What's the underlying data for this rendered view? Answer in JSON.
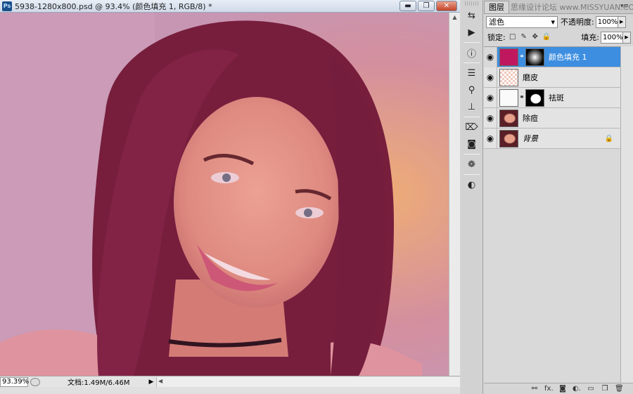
{
  "document": {
    "app_badge": "Ps",
    "title": "5938-1280x800.psd @ 93.4% (颜色填充 1, RGB/8) *",
    "window_buttons": {
      "minimize": "▬",
      "maximize": "❐",
      "close": "✕"
    },
    "zoom": "93.39%",
    "doc_size": "文档:1.49M/6.46M",
    "status_arrow": "▶",
    "scroll_up": "▲",
    "scroll_left": "◀"
  },
  "dock": {
    "icons": [
      "history-icon",
      "actions-icon",
      "info-icon",
      "adjustments-icon",
      "paths-icon",
      "stamp-icon",
      "brush-presets-icon",
      "mask-icon",
      "swatches-icon",
      "styles-icon"
    ],
    "glyphs": [
      "⇆",
      "▶",
      "ⓘ",
      "☰",
      "⚲",
      "⊥",
      "⌦",
      "◙",
      "❁",
      "◐"
    ]
  },
  "layers_panel": {
    "tab_label": "图层",
    "watermark": "思缘设计论坛 www.MISSYUAN.COM",
    "menu_glyph": "▾≡",
    "blend_mode": "滤色",
    "opacity_label": "不透明度:",
    "opacity_value": "100%",
    "lock_label": "锁定:",
    "fill_label": "填充:",
    "fill_value": "100%",
    "lock_glyphs": [
      "□",
      "✎",
      "✥",
      "🔒"
    ],
    "layers": [
      {
        "name": "颜色填充 1",
        "selected": true,
        "thumb_color": "#c0185e",
        "has_mask": true,
        "mask_style": "radial"
      },
      {
        "name": "磨皮",
        "selected": false,
        "thumb_color": "#f0c8bc",
        "has_mask": false
      },
      {
        "name": "祛斑",
        "selected": false,
        "thumb_color": "#fafafa",
        "has_mask": true,
        "mask_style": "face"
      },
      {
        "name": "除痘",
        "selected": false,
        "thumb_color": "#8a4a3a",
        "has_mask": false
      },
      {
        "name": "背景",
        "selected": false,
        "thumb_color": "#8a4a3a",
        "has_mask": false,
        "locked": true
      }
    ],
    "footer_glyphs": [
      "⚯",
      "fx.",
      "◙",
      "◐.",
      "▭",
      "❒",
      "🗑"
    ]
  },
  "colors": {
    "selection": "#3d8ee0",
    "fill_layer": "#c0185e"
  }
}
